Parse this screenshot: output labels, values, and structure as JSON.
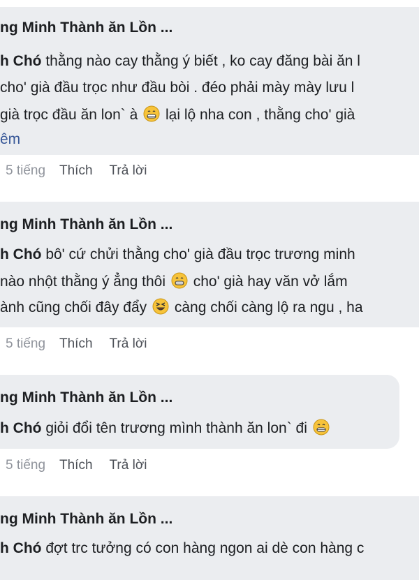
{
  "comments": [
    {
      "author": "ng Minh Thành ăn Lồn ...",
      "lines": [
        {
          "name": "h Chó",
          "text": " thằng nào cay thằng ý biết , ko cay đăng bài ăn l"
        },
        {
          "text": " cho' già đầu trọc như đầu bòi . đéo phải mày mày lưu l"
        },
        {
          "pre": " già trọc đầu ăn lon` à ",
          "emoji": "grin-emoji",
          "post": " lại lộ nha con , thằng cho' già"
        }
      ],
      "see_more": "êm",
      "time": "5 tiếng",
      "like": "Thích",
      "reply": "Trả lời"
    },
    {
      "author": "ng Minh Thành ăn Lồn ...",
      "lines": [
        {
          "name": "h Chó",
          "text": " bô' cứ chửi thằng cho' già đầu trọc trương minh"
        },
        {
          "pre": " nào nhột thằng ý ẳng thôi ",
          "emoji": "grin-emoji",
          "post": " cho' già hay văn vở lắm"
        },
        {
          "pre": "ành cũng chối đây đẩy ",
          "emoji": "laughing-squint-emoji",
          "post": " càng chối càng lộ ra ngu , ha"
        }
      ],
      "time": "5 tiếng",
      "like": "Thích",
      "reply": "Trả lời"
    },
    {
      "author": "ng Minh Thành ăn Lồn ...",
      "lines": [
        {
          "name": "h Chó",
          "pre": " giỏi đổi tên trương mình thành ăn lon` đi ",
          "emoji": "grin-emoji",
          "post": ""
        }
      ],
      "time": "5 tiếng",
      "like": "Thích",
      "reply": "Trả lời"
    },
    {
      "author": "ng Minh Thành ăn Lồn ...",
      "lines": [
        {
          "name": "h Chó",
          "text": " đợt trc tưởng có con hàng ngon ai dè con hàng c"
        }
      ]
    }
  ],
  "colors": {
    "bubble": "#ebedf0",
    "text": "#1c1e21",
    "link": "#385898",
    "meta": "#90949c",
    "emoji": "#f7c33a"
  }
}
